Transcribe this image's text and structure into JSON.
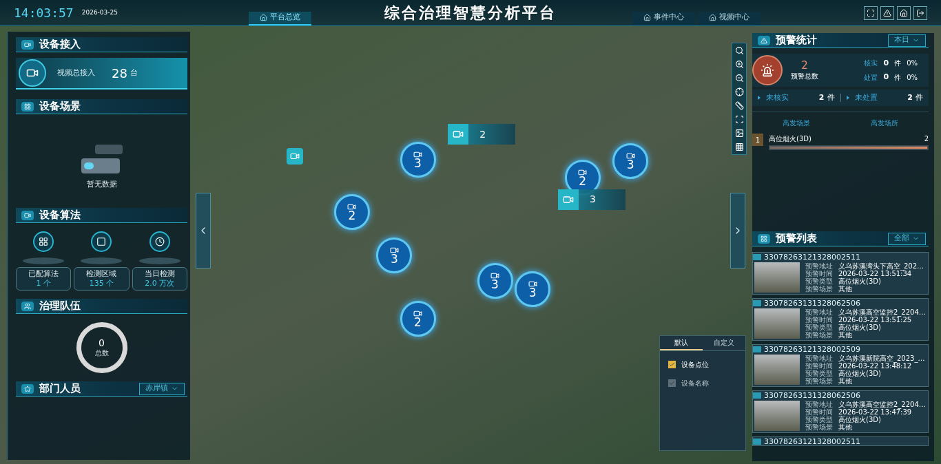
{
  "header": {
    "time": "14:03:57",
    "date": "2026-03-25",
    "title": "综合治理智慧分析平台",
    "nav": [
      {
        "label": "平台总览",
        "selected": true
      },
      {
        "label": "事件中心",
        "selected": false
      },
      {
        "label": "视频中心",
        "selected": false
      }
    ]
  },
  "left": {
    "access": {
      "title": "设备接入",
      "label": "视频总接入",
      "value": "28",
      "unit": "台"
    },
    "scene": {
      "title": "设备场景",
      "empty": "暂无数据"
    },
    "algorithm": {
      "title": "设备算法",
      "stats": [
        {
          "kind": "algo",
          "label": "已配算法",
          "value": "1",
          "unit": "个"
        },
        {
          "kind": "area",
          "label": "检测区域",
          "value": "135",
          "unit": "个"
        },
        {
          "kind": "daily",
          "label": "当日检测",
          "value": "2.0",
          "unit": "万次"
        }
      ]
    },
    "team": {
      "title": "治理队伍",
      "value": "0",
      "label": "总数"
    },
    "staff": {
      "title": "部门人员",
      "filter": "赤岸镇"
    }
  },
  "map": {
    "clusters": [
      {
        "kind": "cluster",
        "count": "3"
      },
      {
        "kind": "cluster",
        "count": "2"
      },
      {
        "kind": "cluster",
        "count": "3"
      },
      {
        "kind": "cluster",
        "count": "2"
      },
      {
        "kind": "cluster",
        "count": "3"
      },
      {
        "kind": "cluster",
        "count": "3"
      },
      {
        "kind": "cluster",
        "count": "2"
      },
      {
        "kind": "cluster",
        "count": "3"
      },
      {
        "kind": "flag",
        "count": "2"
      },
      {
        "kind": "flag",
        "count": "3"
      },
      {
        "kind": "single"
      }
    ],
    "layers": {
      "tabs": [
        {
          "label": "默认",
          "selected": true
        },
        {
          "label": "自定义",
          "selected": false
        }
      ],
      "options": [
        {
          "label": "设备点位",
          "checked": true,
          "disabled": false
        },
        {
          "label": "设备名称",
          "checked": true,
          "disabled": true
        }
      ]
    }
  },
  "right": {
    "stats": {
      "title": "预警统计",
      "filter": "本日",
      "total": "2",
      "total_label": "预警总数",
      "rates": [
        {
          "label": "核实",
          "value": "0",
          "unit": "件",
          "percent": "0%"
        },
        {
          "label": "处置",
          "value": "0",
          "unit": "件",
          "percent": "0%"
        }
      ],
      "pending": [
        {
          "label": "未核实",
          "value": "2",
          "unit": "件"
        },
        {
          "label": "未处置",
          "value": "2",
          "unit": "件"
        }
      ],
      "columns": [
        "高发场景",
        "高发场所"
      ],
      "ranking": [
        {
          "rank": "1",
          "name": "高位烟火(3D)",
          "value": "2",
          "level": 1
        }
      ]
    },
    "list": {
      "title": "预警列表",
      "filter": "全部",
      "alerts": [
        {
          "id": "33078263121328002511",
          "fields": [
            {
              "label": "预警地址",
              "value": "义乌苏溪湾头下高空_202…"
            },
            {
              "label": "预警时间",
              "value": "2026-03-22 13:51:34"
            },
            {
              "label": "预警类型",
              "value": "高位烟火(3D)"
            },
            {
              "label": "预警场景",
              "value": "其他"
            }
          ]
        },
        {
          "id": "33078263131328062506",
          "fields": [
            {
              "label": "预警地址",
              "value": "义乌苏溪高空监控2_2204…"
            },
            {
              "label": "预警时间",
              "value": "2026-03-22 13:51:25"
            },
            {
              "label": "预警类型",
              "value": "高位烟火(3D)"
            },
            {
              "label": "预警场景",
              "value": "其他"
            }
          ]
        },
        {
          "id": "33078263121328002509",
          "fields": [
            {
              "label": "预警地址",
              "value": "义乌苏溪新院高空_2023_…"
            },
            {
              "label": "预警时间",
              "value": "2026-03-22 13:48:12"
            },
            {
              "label": "预警类型",
              "value": "高位烟火(3D)"
            },
            {
              "label": "预警场景",
              "value": "其他"
            }
          ]
        },
        {
          "id": "33078263131328062506",
          "fields": [
            {
              "label": "预警地址",
              "value": "义乌苏溪高空监控2_2204…"
            },
            {
              "label": "预警时间",
              "value": "2026-03-22 13:47:39"
            },
            {
              "label": "预警类型",
              "value": "高位烟火(3D)"
            },
            {
              "label": "预警场景",
              "value": "其他"
            }
          ]
        },
        {
          "id": "33078263121328002511"
        }
      ]
    }
  }
}
